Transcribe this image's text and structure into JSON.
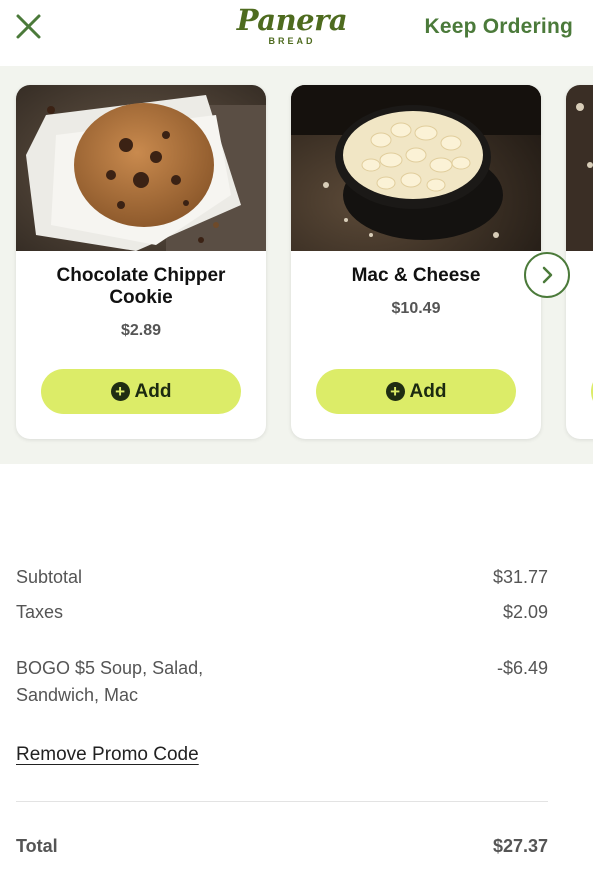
{
  "header": {
    "logo_text": "Panera",
    "logo_subtext": "BREAD",
    "keep_ordering_label": "Keep Ordering",
    "close_icon": "close-icon"
  },
  "colors": {
    "brand_green": "#4b7a3a",
    "add_button": "#dcec68",
    "carousel_bg": "#f2f4ee"
  },
  "upsell": {
    "items": [
      {
        "name": "Chocolate Chipper Cookie",
        "price": "$2.89",
        "add_label": "Add"
      },
      {
        "name": "Mac & Cheese",
        "price": "$10.49",
        "add_label": "Add"
      }
    ],
    "next_icon": "chevron-right-icon"
  },
  "summary": {
    "subtotal_label": "Subtotal",
    "subtotal_value": "$31.77",
    "taxes_label": "Taxes",
    "taxes_value": "$2.09",
    "promo_label": "BOGO $5 Soup, Salad, Sandwich, Mac",
    "promo_value": "-$6.49",
    "remove_promo_label": "Remove Promo Code",
    "total_label": "Total",
    "total_value": "$27.37"
  }
}
